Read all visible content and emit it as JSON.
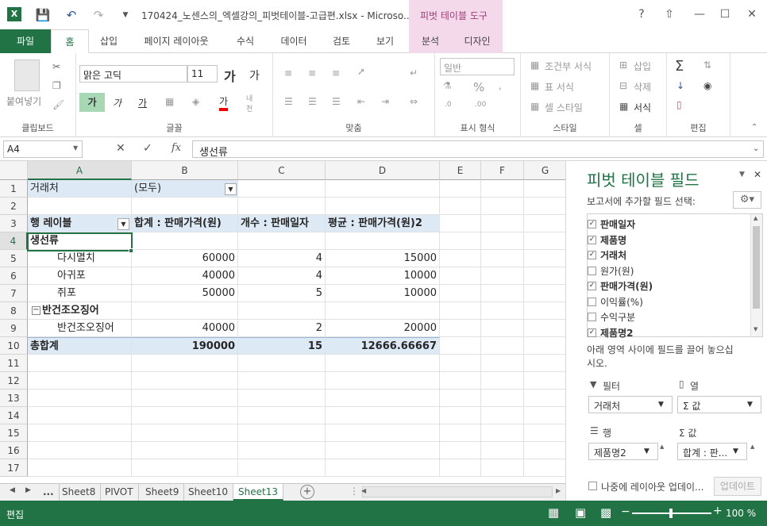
{
  "window": {
    "title": "170424_노센스의_엑셀강의_피벗테이블-고급편.xlsx - Microso...",
    "context_tab_group": "피벗 테이블 도구",
    "help": "?",
    "controls": {
      "min": "—",
      "restore": "☐",
      "close": "✕"
    }
  },
  "ribbon_tabs": [
    "파일",
    "홈",
    "삽입",
    "페이지 레이아웃",
    "수식",
    "데이터",
    "검토",
    "보기",
    "분석",
    "디자인"
  ],
  "ribbon": {
    "clipboard": {
      "paste": "붙여넣기",
      "label": "클립보드"
    },
    "font": {
      "name": "맑은 고딕",
      "size": "11",
      "grow": "가",
      "shrink": "가",
      "bold": "가",
      "italic": "가",
      "underline": "가",
      "font_color": "가",
      "phonetic": "내천",
      "label": "글꼴"
    },
    "alignment": {
      "label": "맞춤"
    },
    "number": {
      "format": "일반",
      "label": "표시 형식"
    },
    "styles": {
      "conditional": "조건부 서식",
      "table": "표 서식",
      "cell": "셀 스타일",
      "label": "스타일"
    },
    "cells": {
      "insert": "삽입",
      "delete": "삭제",
      "format": "서식",
      "label": "셀"
    },
    "editing": {
      "label": "편집"
    }
  },
  "formula_bar": {
    "name_box": "A4",
    "fx": "fx",
    "value": "생선류"
  },
  "grid": {
    "columns": [
      "A",
      "B",
      "C",
      "D",
      "E",
      "F",
      "G"
    ],
    "rows": [
      "1",
      "2",
      "3",
      "4",
      "5",
      "6",
      "7",
      "8",
      "9",
      "10",
      "11",
      "12",
      "13",
      "14",
      "15",
      "16",
      "17"
    ],
    "filter": {
      "label": "거래처",
      "value": "(모두)"
    },
    "pivot_header": {
      "rows": "행 레이블",
      "sum": "합계 : 판매가격(원)",
      "count": "개수 : 판매일자",
      "avg": "평균 : 판매가격(원)2"
    },
    "pivot_rows": [
      {
        "label": "생선류",
        "level": 0,
        "b": "",
        "c": "",
        "d": ""
      },
      {
        "label": "다시멸치",
        "level": 1,
        "b": "60000",
        "c": "4",
        "d": "15000"
      },
      {
        "label": "아귀포",
        "level": 1,
        "b": "40000",
        "c": "4",
        "d": "10000"
      },
      {
        "label": "쥐포",
        "level": 1,
        "b": "50000",
        "c": "5",
        "d": "10000"
      },
      {
        "label": "반건조오징어",
        "level": 0,
        "b": "",
        "c": "",
        "d": ""
      },
      {
        "label": "반건조오징어",
        "level": 1,
        "b": "40000",
        "c": "2",
        "d": "20000"
      }
    ],
    "total": {
      "label": "총합계",
      "b": "190000",
      "c": "15",
      "d": "12666.66667"
    }
  },
  "sheet_tabs": [
    "...",
    "Sheet8",
    "PIVOT",
    "Sheet9",
    "Sheet10",
    "Sheet13"
  ],
  "active_sheet": "Sheet13",
  "status": {
    "mode": "편집",
    "zoom": "100 %"
  },
  "pivot_pane": {
    "title": "피벗 테이블 필드",
    "subtitle": "보고서에 추가할 필드 선택:",
    "fields": [
      {
        "name": "판매일자",
        "checked": true
      },
      {
        "name": "제품명",
        "checked": true
      },
      {
        "name": "거래처",
        "checked": true
      },
      {
        "name": "원가(원)",
        "checked": false
      },
      {
        "name": "판매가격(원)",
        "checked": true
      },
      {
        "name": "이익률(%)",
        "checked": false
      },
      {
        "name": "수익구분",
        "checked": false
      },
      {
        "name": "제품명2",
        "checked": true
      }
    ],
    "drag_hint": "아래 영역 사이에 필드를 끌어 놓으십시오.",
    "areas": {
      "filter": {
        "label": "필터",
        "item": "거래처"
      },
      "columns": {
        "label": "열",
        "item": "Σ 값"
      },
      "rows": {
        "label": "행",
        "item": "제품명2"
      },
      "values": {
        "label": "Σ 값",
        "item": "합계 : 판..."
      }
    },
    "defer": "나중에 레이아웃 업데이...",
    "update": "업데이트"
  },
  "colors": {
    "excel_green": "#217346",
    "context_pink": "#f3d9ea",
    "pivot_band": "#dde9f5"
  }
}
